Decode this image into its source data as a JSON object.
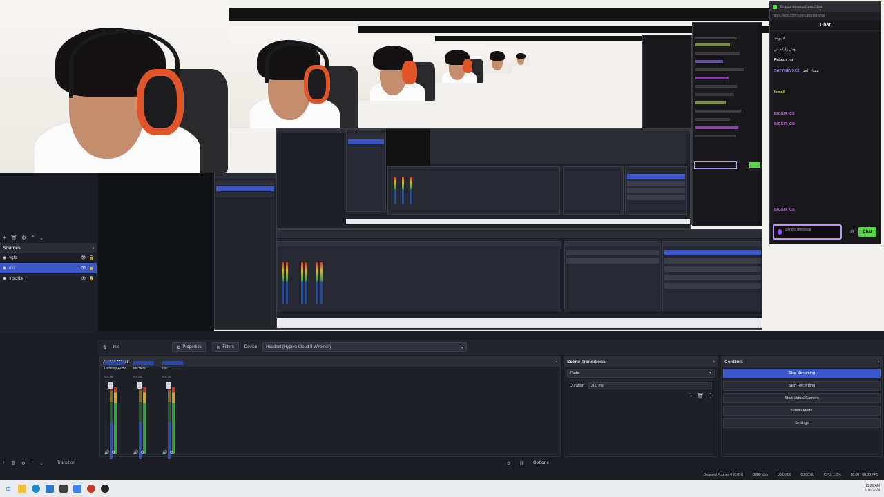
{
  "chat": {
    "url": "Kick.com/popout/xyzer/chat",
    "addr": "https://kick.com/popout/xyzer/chat",
    "title": "Chat",
    "placeholder": "Send a message",
    "send_label": "Chat",
    "messages": [
      {
        "user": "",
        "text": "لا يوجد",
        "color": "#dedee3"
      },
      {
        "user": "",
        "text": "وش رايكم بي",
        "color": "#dedee3"
      },
      {
        "user": "Fahadx_nr",
        "text": "",
        "color": "#dedee3"
      },
      {
        "user": "SATYREVXXX",
        "text": "مساء الخير",
        "color": "#9b7bff"
      },
      {
        "user": "",
        "text": "",
        "color": "#dedee3"
      },
      {
        "user": "Ismail",
        "text": "",
        "color": "#b4e35a"
      },
      {
        "user": "",
        "text": "",
        "color": "#dedee3"
      },
      {
        "user": "BIGSIR_CS",
        "text": "",
        "color": "#d25bff"
      },
      {
        "user": "BIGSIR_CS",
        "text": "",
        "color": "#d25bff"
      },
      {
        "user": "",
        "text": "",
        "color": "#dedee3"
      },
      {
        "user": "",
        "text": "",
        "color": "#dedee3"
      },
      {
        "user": "",
        "text": "",
        "color": "#dedee3"
      },
      {
        "user": "",
        "text": "",
        "color": "#dedee3"
      },
      {
        "user": "",
        "text": "",
        "color": "#dedee3"
      },
      {
        "user": "",
        "text": "",
        "color": "#dedee3"
      },
      {
        "user": "",
        "text": "",
        "color": "#dedee3"
      },
      {
        "user": "BIGSIR_CS",
        "text": "",
        "color": "#d25bff"
      }
    ]
  },
  "sources": {
    "title": "Sources",
    "items": [
      {
        "label": "vgfb",
        "selected": false
      },
      {
        "label": "mic",
        "selected": true
      },
      {
        "label": "Inscribe",
        "selected": false
      }
    ]
  },
  "source_bar": {
    "current": "mic",
    "properties": "Properties",
    "filters": "Filters",
    "device_label": "Device",
    "device_value": "Headset (Hyperx Cloud II Wireless)"
  },
  "mixer": {
    "title": "Audio Mixer",
    "channels": [
      {
        "name": "Desktop Audio",
        "db": "0.0 dB"
      },
      {
        "name": "Mic/Aux",
        "db": "0.0 dB"
      },
      {
        "name": "mic",
        "db": "0.0 dB"
      }
    ]
  },
  "transitions": {
    "title": "Scene Transitions",
    "type": "Fade",
    "duration_label": "Duration",
    "duration_value": "300 ms"
  },
  "controls": {
    "title": "Controls",
    "buttons": [
      "Stop Streaming",
      "Start Recording",
      "Start Virtual Camera",
      "Studio Mode",
      "Settings"
    ]
  },
  "footer": {
    "options": "Options",
    "scenes_label": "Transition"
  },
  "status": {
    "dropped": "Dropped Frames 0 (0.0%)",
    "kbps": "3000 kb/s",
    "live": "00:00:00",
    "rec": "00:00:00",
    "cpu": "CPU: 1.2%",
    "fps": "60.00 / 60.00 FPS"
  },
  "taskbar": {
    "time": "11:26 AM",
    "date": "2/19/2024"
  },
  "colors": {
    "accent": "#3b56c6",
    "kick_green": "#55d645"
  }
}
